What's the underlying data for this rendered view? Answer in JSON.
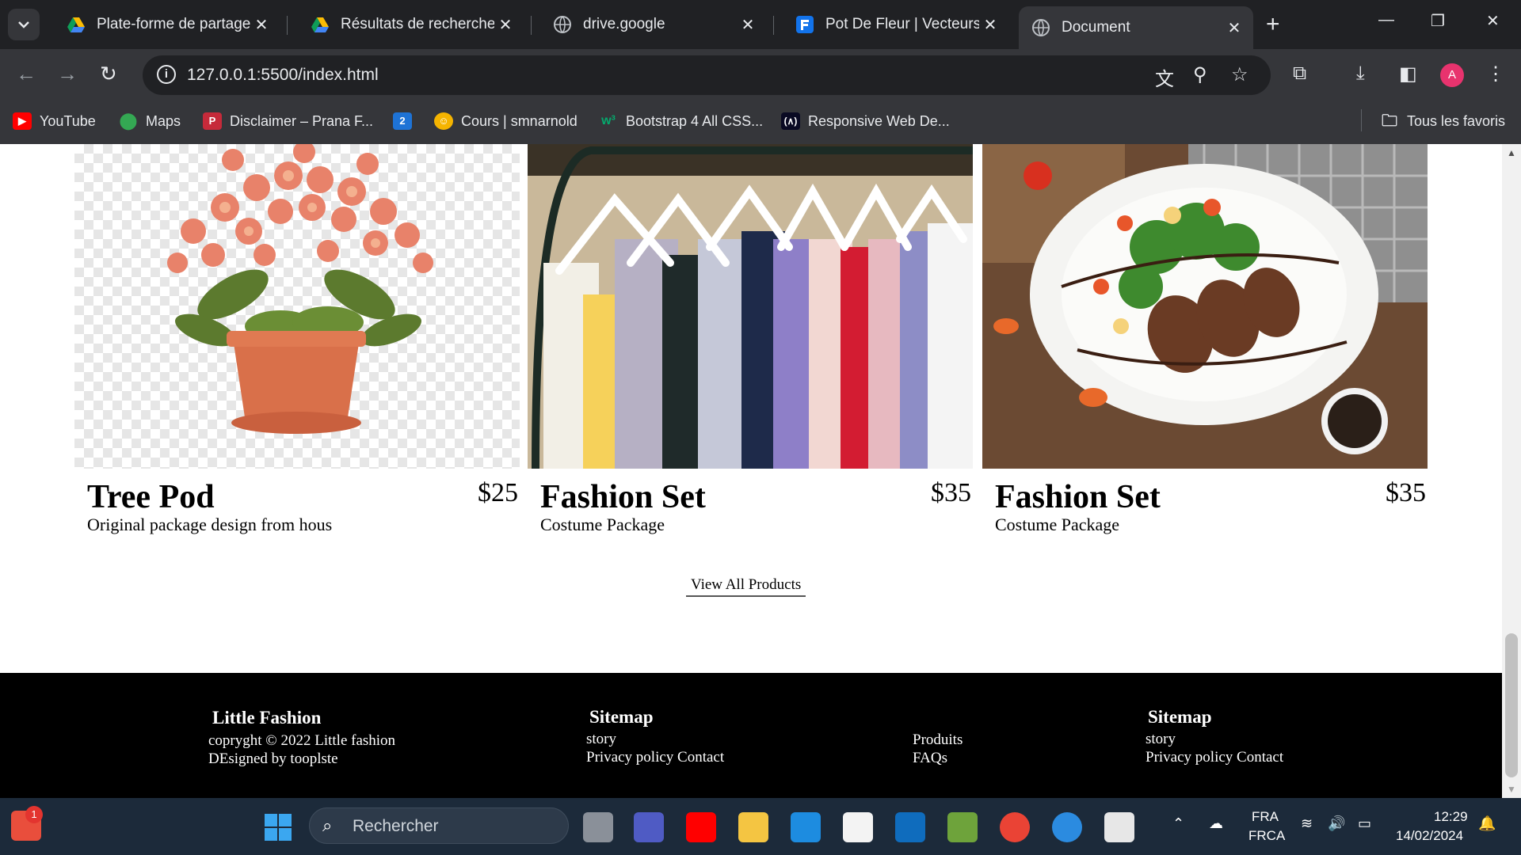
{
  "browser": {
    "tabs": [
      {
        "title": "Plate-forme de partage d",
        "icon": "google-drive-icon"
      },
      {
        "title": "Résultats de recherche - ",
        "icon": "google-drive-icon"
      },
      {
        "title": "drive.google",
        "icon": "globe-icon"
      },
      {
        "title": "Pot De Fleur | Vecteurs et",
        "icon": "freepik-icon"
      },
      {
        "title": "Document",
        "icon": "globe-icon",
        "active": true
      }
    ],
    "url": "127.0.0.1:5500/index.html",
    "bookmarks": [
      {
        "label": "YouTube",
        "icon": "youtube-icon"
      },
      {
        "label": "Maps",
        "icon": "maps-icon"
      },
      {
        "label": "Disclaimer – Prana F...",
        "icon": "prana-icon"
      },
      {
        "label": "",
        "icon": "number-2-icon",
        "badge_text": "2"
      },
      {
        "label": "Cours | smnarnold",
        "icon": "cours-icon"
      },
      {
        "label": "Bootstrap 4 All CSS...",
        "icon": "w3-icon"
      },
      {
        "label": "Responsive Web De...",
        "icon": "freecodecamp-icon"
      }
    ],
    "all_bookmarks_label": "Tous les favoris",
    "profile_initial": "A"
  },
  "products": [
    {
      "name": "Tree Pod",
      "price": "$25",
      "description": "Original package design from hous",
      "image": "flower-pot-image"
    },
    {
      "name": "Fashion Set",
      "price": "$35",
      "description": "Costume Package",
      "image": "clothes-rack-image"
    },
    {
      "name": "Fashion Set",
      "price": "$35",
      "description": "Costume Package",
      "image": "salad-plate-image"
    }
  ],
  "view_all_label": "View All Products",
  "footer": {
    "brand_title": "Little Fashion",
    "copyright": "copryght © 2022 Little fashion",
    "designed_by": "DEsigned by tooplste",
    "sitemap_title": "Sitemap",
    "story": "story",
    "privacy_contact": "Privacy policy Contact",
    "produits": "Produits",
    "faqs": "FAQs",
    "sitemap2_title": "Sitemap",
    "story2": "story",
    "privacy_contact2": "Privacy policy Contact"
  },
  "taskbar": {
    "search_placeholder": "Rechercher",
    "notification_count": "1",
    "lang_top": "FRA",
    "lang_bottom": "FRCA",
    "time": "12:29",
    "date": "14/02/2024"
  }
}
